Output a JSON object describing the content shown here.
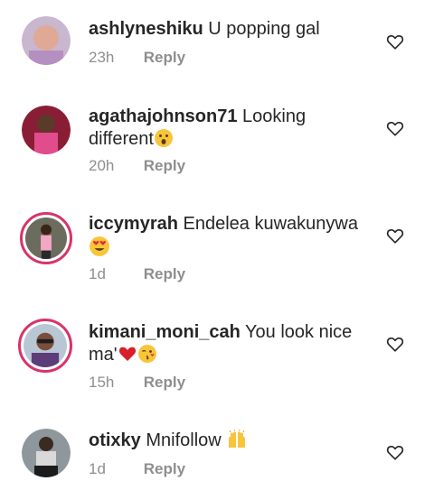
{
  "comments": [
    {
      "username": "ashlyneshiku",
      "text": "U popping gal",
      "time": "23h",
      "reply_label": "Reply"
    },
    {
      "username": "agathajohnson71",
      "text": "Looking different",
      "time": "20h",
      "reply_label": "Reply"
    },
    {
      "username": "iccymyrah",
      "text": "Endelea kuwakunywa",
      "time": "1d",
      "reply_label": "Reply"
    },
    {
      "username": "kimani_moni_cah",
      "text": "You look nice ma'",
      "time": "15h",
      "reply_label": "Reply"
    },
    {
      "username": "otixky",
      "text": "Mnifollow",
      "time": "1d",
      "reply_label": "Reply"
    }
  ],
  "icons": {
    "like": "heart-outline-icon",
    "emoji_1": "astonished-face-emoji",
    "emoji_2": "heart-eyes-emoji",
    "emoji_3": "red-heart-emoji",
    "emoji_4": "face-blowing-kiss-emoji",
    "emoji_5": "raising-hands-emoji"
  },
  "colors": {
    "text": "#262626",
    "secondary": "#8e8e8e",
    "story_ring": "#d8336a"
  }
}
